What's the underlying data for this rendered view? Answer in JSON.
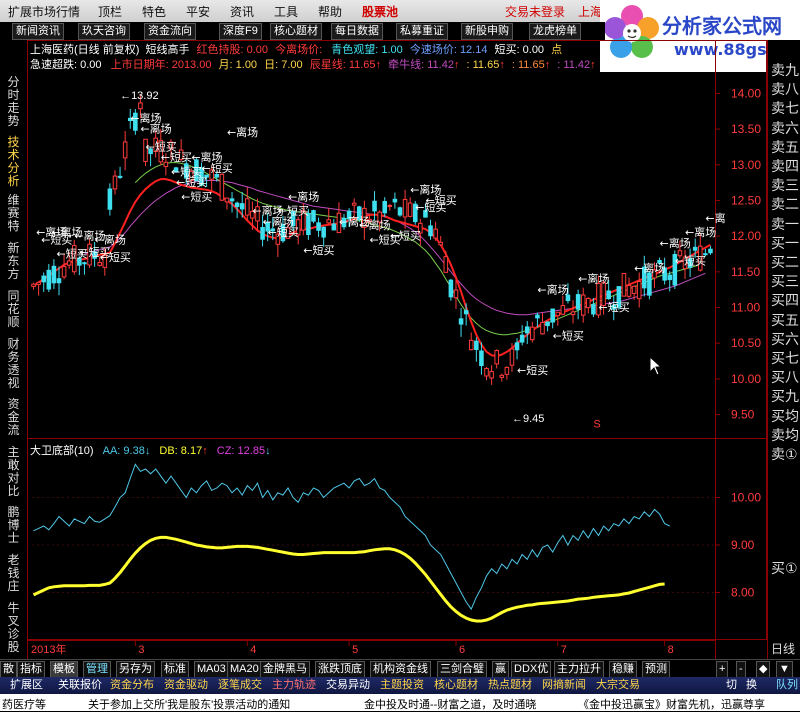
{
  "menu": {
    "items": [
      "扩展市场行情",
      "顶栏",
      "特色",
      "平安",
      "资讯",
      "工具",
      "帮助"
    ],
    "pool_label": "股票池",
    "login_status": "交易未登录",
    "city": "上海"
  },
  "logo": {
    "brand": "分析家公式网",
    "url": "www.88gs.com"
  },
  "tabs": [
    "新闻资讯",
    "玖天咨询",
    "资金流向",
    "深度F9",
    "核心题材",
    "每日数据",
    "私募重证",
    "新股申购",
    "龙虎榜单"
  ],
  "info": {
    "line1": {
      "title": "上海医药(日线 前复权)",
      "indicator": "短线高手",
      "red_hold": "红色持股: 0.00",
      "leave": "今离场价:",
      "cyan_watch": "青色观望: 1.00",
      "speed": "今速场价: 12.14",
      "short_buy": "短买: 0.00",
      "tail": "点"
    },
    "line2": {
      "drop": "急速超跌: 0.00",
      "listing": "上市日期年: 2013.00",
      "month": "月: 1.00",
      "day": "日: 7.00",
      "star": "辰星线: 11.65",
      "bull": "牵牛线: 11.42",
      "v1": ": 11.65",
      "v2": ": 11.65",
      "v3": ": 11.42"
    }
  },
  "sub_info": {
    "name": "大卫底部(10)",
    "aa": "AA: 9.38",
    "db": "DB: 8.17",
    "cz": "CZ: 12.85"
  },
  "sidebar": {
    "items": [
      "分时走势",
      "技术分析",
      "维赛特",
      "新东方",
      "同花顺",
      "财务透视",
      "资金流",
      "主敢对比",
      "鹏博士",
      "老钱庄",
      "牛叉诊股"
    ]
  },
  "orderbook": {
    "items": [
      "卖九",
      "卖八",
      "卖七",
      "卖六",
      "卖五",
      "卖四",
      "卖三",
      "卖二",
      "卖一",
      "买一",
      "买二",
      "买三",
      "买四",
      "买五",
      "买六",
      "买七",
      "买八",
      "买九",
      "买均",
      "卖均",
      "卖①"
    ],
    "sub_label": "买①",
    "period": "日线"
  },
  "colors": {
    "up": "#ff3b3b",
    "down": "#3ee0f0",
    "ma_red": "#ff2020",
    "ma_green": "#7ad04c",
    "ma_purple": "#c04cc0",
    "aa_line": "#4fc8e8",
    "db_line": "#ffff30",
    "frame": "#8b0000"
  },
  "chart_data": [
    {
      "type": "candlestick",
      "title": "上海医药(日线 前复权)",
      "yticks": [
        14.0,
        13.5,
        13.0,
        12.5,
        12.0,
        11.5,
        11.0,
        10.5,
        10.0,
        9.5
      ],
      "ylim": [
        9.2,
        14.3
      ],
      "year_label": "2013年",
      "month_ticks": [
        "3",
        "4",
        "5",
        "6",
        "7",
        "8"
      ],
      "max_label": "13.92",
      "min_label": "9.45",
      "signal_marker": "S",
      "annotations": [
        {
          "text": "离场",
          "x": 0.5,
          "y": 12.0
        },
        {
          "text": "短买",
          "x": 1.5,
          "y": 11.9
        },
        {
          "text": "离场",
          "x": 3.5,
          "y": 12.0
        },
        {
          "text": "短买",
          "x": 4.5,
          "y": 11.7
        },
        {
          "text": "离场",
          "x": 8,
          "y": 11.95
        },
        {
          "text": "短买",
          "x": 9,
          "y": 11.72
        },
        {
          "text": "离场",
          "x": 12,
          "y": 11.9
        },
        {
          "text": "短买",
          "x": 13,
          "y": 11.65
        },
        {
          "text": "离场",
          "x": 19,
          "y": 13.6
        },
        {
          "text": "离场",
          "x": 21,
          "y": 13.45
        },
        {
          "text": "短买",
          "x": 22,
          "y": 13.2
        },
        {
          "text": "短买",
          "x": 25,
          "y": 13.05
        },
        {
          "text": "短买",
          "x": 27,
          "y": 12.85
        },
        {
          "text": "短买",
          "x": 28,
          "y": 12.7
        },
        {
          "text": "短买",
          "x": 29,
          "y": 12.5
        },
        {
          "text": "离场",
          "x": 31,
          "y": 13.05
        },
        {
          "text": "短买",
          "x": 33,
          "y": 12.9
        },
        {
          "text": "离场",
          "x": 38,
          "y": 13.4
        },
        {
          "text": "离场",
          "x": 43,
          "y": 12.3
        },
        {
          "text": "离场",
          "x": 45,
          "y": 12.15
        },
        {
          "text": "短买",
          "x": 46,
          "y": 12.0
        },
        {
          "text": "短买",
          "x": 48,
          "y": 12.3
        },
        {
          "text": "离场",
          "x": 50,
          "y": 12.5
        },
        {
          "text": "短买",
          "x": 53,
          "y": 11.75
        },
        {
          "text": "离场",
          "x": 60,
          "y": 12.15
        },
        {
          "text": "离场",
          "x": 64,
          "y": 12.1
        },
        {
          "text": "短买",
          "x": 66,
          "y": 11.9
        },
        {
          "text": "短买",
          "x": 70,
          "y": 11.95
        },
        {
          "text": "离场",
          "x": 74,
          "y": 12.6
        },
        {
          "text": "短买",
          "x": 75,
          "y": 12.35
        },
        {
          "text": "短买",
          "x": 77,
          "y": 12.45
        },
        {
          "text": "短买",
          "x": 95,
          "y": 10.07
        },
        {
          "text": "离场",
          "x": 99,
          "y": 11.2
        },
        {
          "text": "短买",
          "x": 102,
          "y": 10.55
        },
        {
          "text": "离场",
          "x": 107,
          "y": 11.35
        },
        {
          "text": "短买",
          "x": 111,
          "y": 10.95
        },
        {
          "text": "离场",
          "x": 118,
          "y": 11.5
        },
        {
          "text": "离场",
          "x": 123,
          "y": 11.85
        },
        {
          "text": "短买",
          "x": 126,
          "y": 11.6
        },
        {
          "text": "离场",
          "x": 128,
          "y": 12.0
        },
        {
          "text": "离",
          "x": 132,
          "y": 12.2
        }
      ],
      "ma_red": [
        11.3,
        11.35,
        11.4,
        11.45,
        11.5,
        11.55,
        11.6,
        11.63,
        11.65,
        11.67,
        11.68,
        11.7,
        11.72,
        11.74,
        11.75,
        11.77,
        11.9,
        12.05,
        12.2,
        12.35,
        12.48,
        12.58,
        12.66,
        12.72,
        12.77,
        12.8,
        12.8,
        12.78,
        12.75,
        12.72,
        12.7,
        12.68,
        12.67,
        12.66,
        12.65,
        12.63,
        12.6,
        12.55,
        12.5,
        12.45,
        12.38,
        12.3,
        12.22,
        12.15,
        12.08,
        12.03,
        12.0,
        11.98,
        11.97,
        11.98,
        12.0,
        12.05,
        12.08,
        12.1,
        12.1,
        12.12,
        12.14,
        12.15,
        12.16,
        12.17,
        12.18,
        12.2,
        12.22,
        12.24,
        12.26,
        12.28,
        12.3,
        12.3,
        12.3,
        12.28,
        12.25,
        12.22,
        12.2,
        12.18,
        12.16,
        12.14,
        12.12,
        12.1,
        12.05,
        11.98,
        11.88,
        11.75,
        11.6,
        11.42,
        11.22,
        11.0,
        10.8,
        10.62,
        10.48,
        10.38,
        10.33,
        10.32,
        10.34,
        10.38,
        10.43,
        10.5,
        10.56,
        10.62,
        10.68,
        10.73,
        10.78,
        10.82,
        10.86,
        10.9,
        10.93,
        10.96,
        10.99,
        11.02,
        11.05,
        11.08,
        11.11,
        11.14,
        11.17,
        11.2,
        11.23,
        11.26,
        11.29,
        11.32,
        11.35,
        11.38,
        11.41,
        11.44,
        11.46,
        11.5,
        11.53,
        11.56,
        11.6,
        11.64,
        11.68,
        11.72,
        11.76,
        11.8,
        11.84,
        11.88
      ],
      "ma_green": [
        null,
        null,
        null,
        null,
        null,
        null,
        null,
        null,
        null,
        null,
        null,
        null,
        null,
        null,
        null,
        null,
        null,
        null,
        null,
        null,
        12.75,
        12.82,
        12.88,
        12.93,
        12.97,
        13.0,
        13.02,
        13.03,
        13.03,
        13.02,
        13.0,
        12.98,
        12.95,
        12.92,
        12.88,
        12.84,
        12.8,
        12.76,
        12.72,
        12.68,
        12.64,
        12.6,
        12.56,
        12.52,
        12.49,
        12.46,
        12.44,
        12.42,
        12.4,
        12.38,
        12.36,
        12.35,
        12.34,
        12.33,
        12.32,
        12.31,
        12.3,
        12.29,
        12.28,
        12.27,
        12.26,
        12.25,
        12.24,
        12.23,
        12.22,
        12.2,
        12.18,
        12.16,
        12.14,
        12.12,
        12.1,
        12.07,
        12.04,
        12.0,
        11.96,
        11.92,
        11.86,
        11.8,
        11.72,
        11.62,
        11.52,
        11.4,
        11.28,
        11.16,
        11.04,
        10.94,
        10.85,
        10.78,
        10.72,
        10.68,
        10.65,
        10.63,
        10.62,
        10.62,
        10.63,
        10.64,
        10.66,
        10.68,
        10.7,
        10.72,
        10.75,
        10.78,
        10.81,
        10.84,
        10.87,
        10.9,
        10.93,
        10.96,
        10.99,
        11.02,
        11.05,
        11.08,
        11.11,
        11.14,
        11.17,
        11.2,
        11.23,
        11.26,
        11.29,
        11.32,
        11.35,
        11.38,
        11.41,
        11.44,
        11.46,
        11.48,
        11.5,
        11.52,
        11.54,
        11.56,
        11.58,
        11.6
      ],
      "ma_purple": [
        null,
        null,
        null,
        null,
        null,
        null,
        null,
        null,
        null,
        null,
        11.75,
        11.77,
        11.79,
        11.81,
        11.83,
        11.85,
        11.9,
        11.97,
        12.05,
        12.14,
        12.22,
        12.3,
        12.37,
        12.44,
        12.5,
        12.55,
        12.6,
        12.64,
        12.68,
        12.71,
        12.73,
        12.75,
        12.76,
        12.77,
        12.78,
        12.78,
        12.78,
        12.77,
        12.76,
        12.75,
        12.73,
        12.71,
        12.69,
        12.67,
        12.64,
        12.62,
        12.6,
        12.58,
        12.56,
        12.54,
        12.52,
        12.5,
        12.48,
        12.46,
        12.44,
        12.42,
        12.41,
        12.4,
        12.39,
        12.38,
        12.37,
        12.36,
        12.35,
        12.34,
        12.33,
        12.32,
        12.31,
        12.3,
        12.29,
        12.27,
        12.25,
        12.22,
        12.19,
        12.15,
        12.11,
        12.06,
        12.0,
        11.93,
        11.85,
        11.77,
        11.68,
        11.59,
        11.5,
        11.41,
        11.33,
        11.25,
        11.18,
        11.12,
        11.07,
        11.03,
        10.99,
        10.96,
        10.94,
        10.92,
        10.91,
        10.9,
        10.9,
        10.9,
        10.91,
        10.92,
        10.93,
        10.94,
        10.95,
        10.96,
        10.97,
        10.98,
        10.99,
        11.0,
        11.01,
        11.02,
        11.03,
        11.04,
        11.05,
        11.06,
        11.07,
        11.08,
        11.1,
        11.12,
        11.14,
        11.16,
        11.18,
        11.2,
        11.22,
        11.24,
        11.26,
        11.28,
        11.3,
        11.33,
        11.36,
        11.39,
        11.42,
        11.45,
        11.48
      ]
    },
    {
      "type": "line",
      "title": "大卫底部(10)",
      "yticks": [
        10.0,
        9.0,
        8.0
      ],
      "ylim": [
        7.0,
        11.0
      ],
      "series": [
        {
          "name": "AA",
          "values": [
            9.3,
            9.35,
            9.4,
            9.32,
            9.45,
            9.6,
            9.5,
            9.4,
            9.55,
            9.5,
            9.45,
            9.6,
            9.5,
            9.48,
            9.55,
            9.62,
            9.8,
            10.0,
            10.1,
            10.4,
            10.7,
            10.55,
            10.6,
            10.5,
            10.6,
            10.45,
            10.3,
            10.45,
            10.3,
            10.15,
            10.0,
            10.2,
            10.1,
            10.25,
            10.35,
            10.15,
            10.2,
            10.3,
            10.25,
            10.1,
            10.2,
            10.05,
            10.25,
            10.15,
            10.3,
            10.0,
            10.15,
            9.95,
            10.1,
            10.05,
            10.2,
            10.0,
            9.9,
            10.1,
            10.05,
            10.2,
            10.15,
            10.0,
            10.1,
            10.2,
            10.25,
            10.3,
            10.2,
            10.35,
            10.4,
            10.25,
            10.3,
            10.4,
            10.2,
            10.15,
            10.0,
            9.9,
            9.8,
            9.6,
            9.5,
            9.4,
            9.3,
            9.2,
            9.0,
            8.9,
            8.8,
            8.6,
            8.4,
            8.2,
            8.0,
            7.8,
            7.65,
            7.9,
            8.1,
            8.35,
            8.5,
            8.4,
            8.6,
            8.5,
            8.7,
            8.6,
            8.8,
            8.7,
            8.9,
            8.75,
            8.95,
            9.0,
            8.85,
            9.05,
            9.2,
            9.0,
            9.2,
            9.1,
            9.3,
            9.15,
            9.35,
            9.2,
            9.4,
            9.3,
            9.45,
            9.4,
            9.55,
            9.45,
            9.6,
            9.55,
            9.7,
            9.6,
            9.75,
            9.65,
            9.45,
            9.4
          ]
        },
        {
          "name": "DB",
          "values": [
            7.95,
            8.0,
            8.05,
            8.1,
            8.12,
            8.13,
            8.14,
            8.14,
            8.14,
            8.14,
            8.14,
            8.15,
            8.15,
            8.15,
            8.17,
            8.2,
            8.3,
            8.42,
            8.56,
            8.7,
            8.83,
            8.94,
            9.03,
            9.1,
            9.14,
            9.16,
            9.16,
            9.14,
            9.12,
            9.09,
            9.06,
            9.03,
            9.0,
            8.98,
            8.96,
            8.95,
            8.94,
            8.94,
            8.95,
            8.96,
            8.97,
            8.97,
            8.97,
            8.96,
            8.95,
            8.93,
            8.91,
            8.89,
            8.87,
            8.85,
            8.83,
            8.81,
            8.8,
            8.8,
            8.81,
            8.82,
            8.83,
            8.84,
            8.84,
            8.84,
            8.84,
            8.84,
            8.84,
            8.84,
            8.85,
            8.86,
            8.88,
            8.9,
            8.91,
            8.92,
            8.92,
            8.9,
            8.86,
            8.8,
            8.72,
            8.62,
            8.5,
            8.38,
            8.24,
            8.1,
            7.96,
            7.82,
            7.7,
            7.6,
            7.52,
            7.46,
            7.42,
            7.4,
            7.4,
            7.42,
            7.46,
            7.52,
            7.58,
            7.63,
            7.66,
            7.69,
            7.71,
            7.73,
            7.74,
            7.76,
            7.77,
            7.78,
            7.79,
            7.8,
            7.81,
            7.82,
            7.84,
            7.86,
            7.87,
            7.88,
            7.9,
            7.91,
            7.92,
            7.93,
            7.94,
            7.95,
            7.97,
            7.99,
            8.02,
            8.05,
            8.08,
            8.11,
            8.14,
            8.17,
            8.18
          ]
        }
      ]
    }
  ],
  "bottom_tabs": [
    "散",
    "指标",
    "模板",
    "管理",
    "另存为",
    "标准",
    "MA03",
    "MA20",
    "金牌黑马",
    "涨跌顶底",
    "机构资金线",
    "三剑合璧",
    "赢",
    "DDX优",
    "主力拉升",
    "稳赚",
    "预测"
  ],
  "bottom_nav": [
    "+",
    "-",
    "◆",
    "▼"
  ],
  "bottom_links": [
    "扩展区",
    "关联报价",
    "资金分布",
    "资金驱动",
    "逐笔成交",
    "主力轨迹",
    "交易异动",
    "主题投资",
    "核心题材",
    "热点题材",
    "网摘新闻",
    "大宗交易",
    "切",
    "换",
    "队列"
  ],
  "ticker": [
    "药医疗等",
    "关于参加上交所'我是股东'投票活动的通知",
    "金中投及时通--财富之道，及时通晓",
    "《金中投迅赢宝》财富先机，迅赢尊享"
  ]
}
